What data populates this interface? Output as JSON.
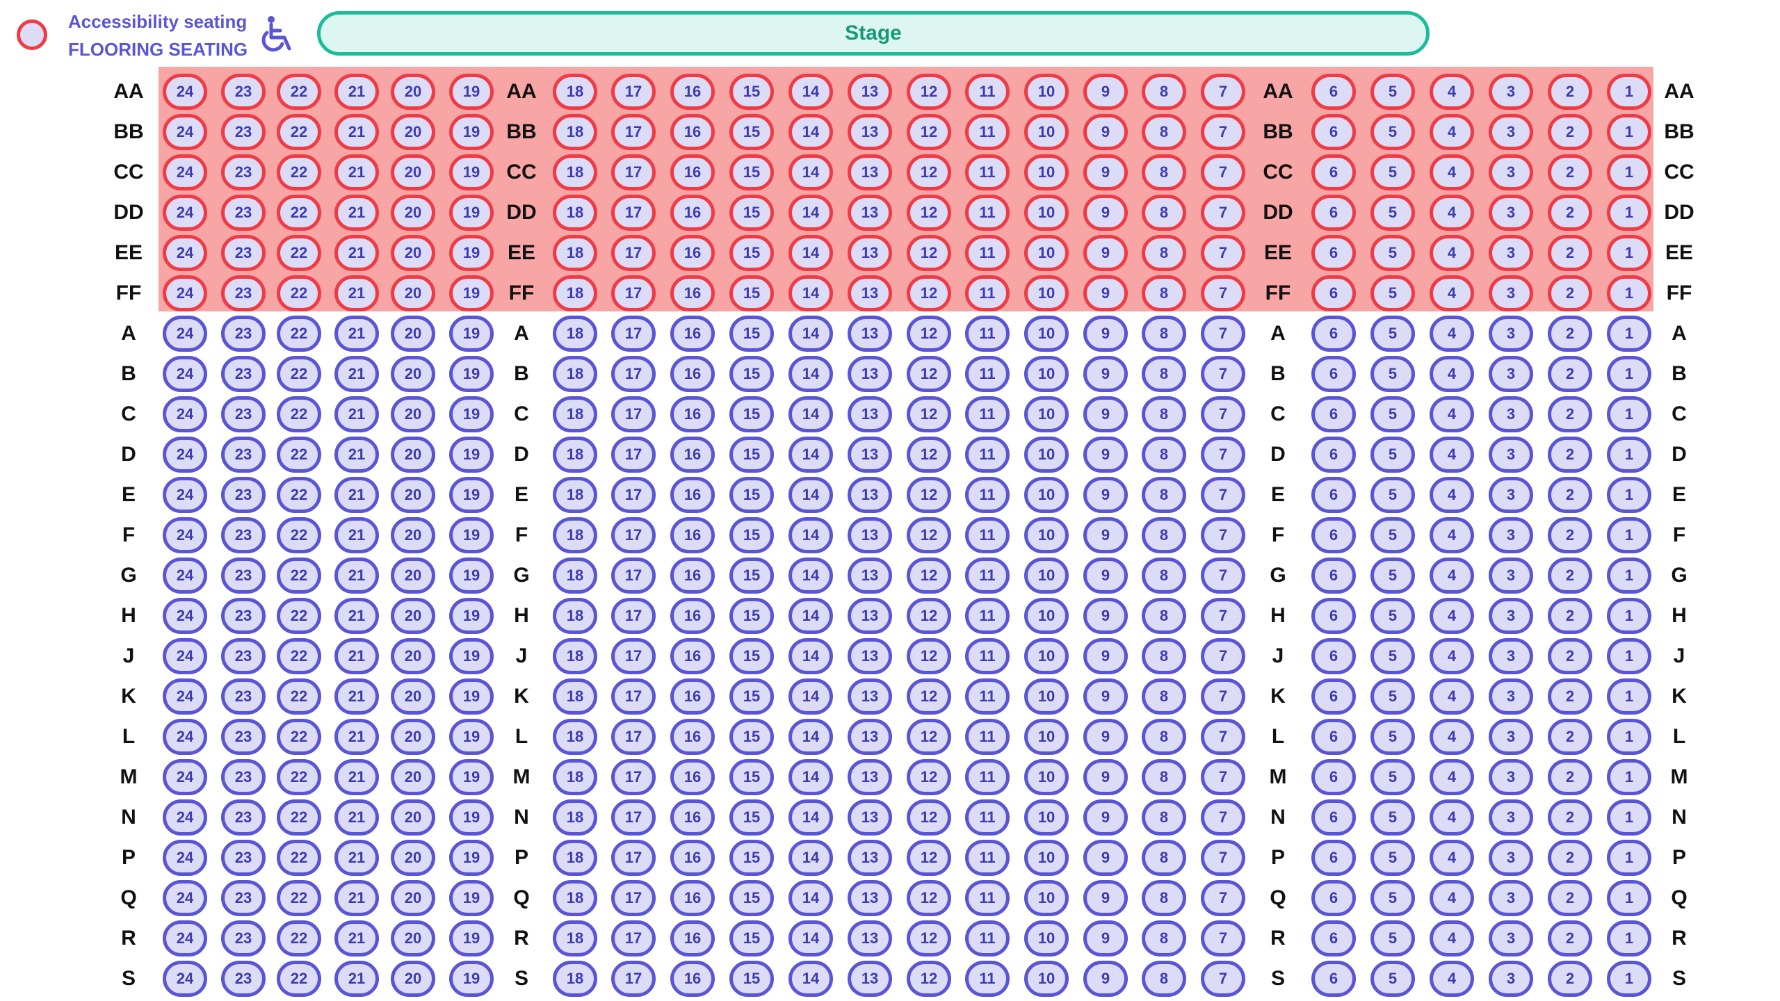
{
  "legend": {
    "accessibility_label": "Accessibility seating",
    "flooring_label": "FLOORING SEATING",
    "floor_icon": "red-outline-circle",
    "accessibility_icon": "wheelchair-icon"
  },
  "stage": {
    "label": "Stage"
  },
  "colors": {
    "seat_fill": "#dcdcf6",
    "seat_border": "#5a55d6",
    "floor_seat_border": "#ef3b45",
    "floor_band": "#f7a5a5",
    "stage_border": "#1abc9c",
    "stage_fill": "#ddf6f1",
    "legend_text": "#5a55d6"
  },
  "seating": {
    "floor_rows": [
      "AA",
      "BB",
      "CC",
      "DD",
      "EE",
      "FF"
    ],
    "rows": [
      "AA",
      "BB",
      "CC",
      "DD",
      "EE",
      "FF",
      "A",
      "B",
      "C",
      "D",
      "E",
      "F",
      "G",
      "H",
      "J",
      "K",
      "L",
      "M",
      "N",
      "P",
      "Q",
      "R",
      "S"
    ],
    "sections": [
      {
        "seats": [
          24,
          23,
          22,
          21,
          20,
          19
        ]
      },
      {
        "seats": [
          18,
          17,
          16,
          15,
          14,
          13,
          12,
          11,
          10,
          9,
          8,
          7
        ]
      },
      {
        "seats": [
          6,
          5,
          4,
          3,
          2,
          1
        ]
      }
    ]
  }
}
